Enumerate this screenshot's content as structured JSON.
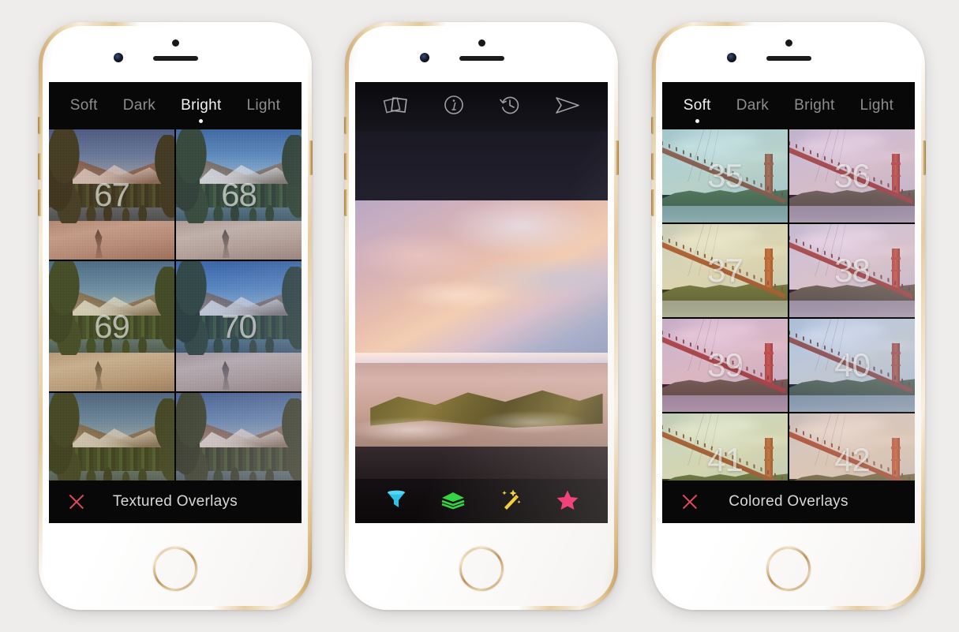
{
  "background_color": "#eeedec",
  "phones": [
    {
      "id": "phone-left",
      "screen_type": "overlay-picker",
      "tabs": [
        {
          "label": "Soft",
          "active": false
        },
        {
          "label": "Dark",
          "active": false
        },
        {
          "label": "Bright",
          "active": true
        },
        {
          "label": "Light",
          "active": false
        }
      ],
      "thumbnails": [
        {
          "number": "67",
          "tint": "rgba(150, 80, 55, 0.32)"
        },
        {
          "number": "68",
          "tint": "rgba(120, 140, 170, 0.26)"
        },
        {
          "number": "69",
          "tint": "rgba(160, 140, 70, 0.30)"
        },
        {
          "number": "70",
          "tint": "rgba(90, 120, 185, 0.30)"
        },
        {
          "number": "",
          "tint": "rgba(150, 120, 60, 0.34)"
        },
        {
          "number": "",
          "tint": "rgba(140, 110, 120, 0.30)"
        }
      ],
      "bottom_bar": {
        "close_icon": "close-x-icon",
        "title": "Textured Overlays",
        "close_color": "#e2485c"
      }
    },
    {
      "id": "phone-center",
      "screen_type": "photo-editor",
      "top_tools": [
        {
          "name": "photo-stack-icon",
          "label": "Photos"
        },
        {
          "name": "info-icon",
          "label": "Info"
        },
        {
          "name": "history-icon",
          "label": "History"
        },
        {
          "name": "send-icon",
          "label": "Send"
        }
      ],
      "bottom_tools": [
        {
          "name": "filter-funnel-icon",
          "label": "Filters",
          "color": "#2bc4e8"
        },
        {
          "name": "layers-icon",
          "label": "Layers",
          "color": "#2fd43f"
        },
        {
          "name": "magic-wand-icon",
          "label": "Enhance",
          "color": "#f5d02e"
        },
        {
          "name": "star-icon",
          "label": "Favorites",
          "color": "#f52a6e"
        }
      ]
    },
    {
      "id": "phone-right",
      "screen_type": "overlay-picker",
      "tabs": [
        {
          "label": "Soft",
          "active": true
        },
        {
          "label": "Dark",
          "active": false
        },
        {
          "label": "Bright",
          "active": false
        },
        {
          "label": "Light",
          "active": false
        }
      ],
      "thumbnails": [
        {
          "number": "35",
          "tint": "rgba(90, 170, 170, 0.34)"
        },
        {
          "number": "36",
          "tint": "rgba(175, 110, 170, 0.34)"
        },
        {
          "number": "37",
          "tint": "rgba(195, 180, 90, 0.32)"
        },
        {
          "number": "38",
          "tint": "rgba(185, 120, 175, 0.32)"
        },
        {
          "number": "39",
          "tint": "rgba(190, 95, 150, 0.34)"
        },
        {
          "number": "40",
          "tint": "rgba(110, 140, 200, 0.32)"
        },
        {
          "number": "41",
          "tint": "rgba(170, 185, 95, 0.32)"
        },
        {
          "number": "42",
          "tint": "rgba(200, 140, 110, 0.34)"
        }
      ],
      "bottom_bar": {
        "close_icon": "close-x-icon",
        "title": "Colored Overlays",
        "close_color": "#e2485c"
      }
    }
  ]
}
